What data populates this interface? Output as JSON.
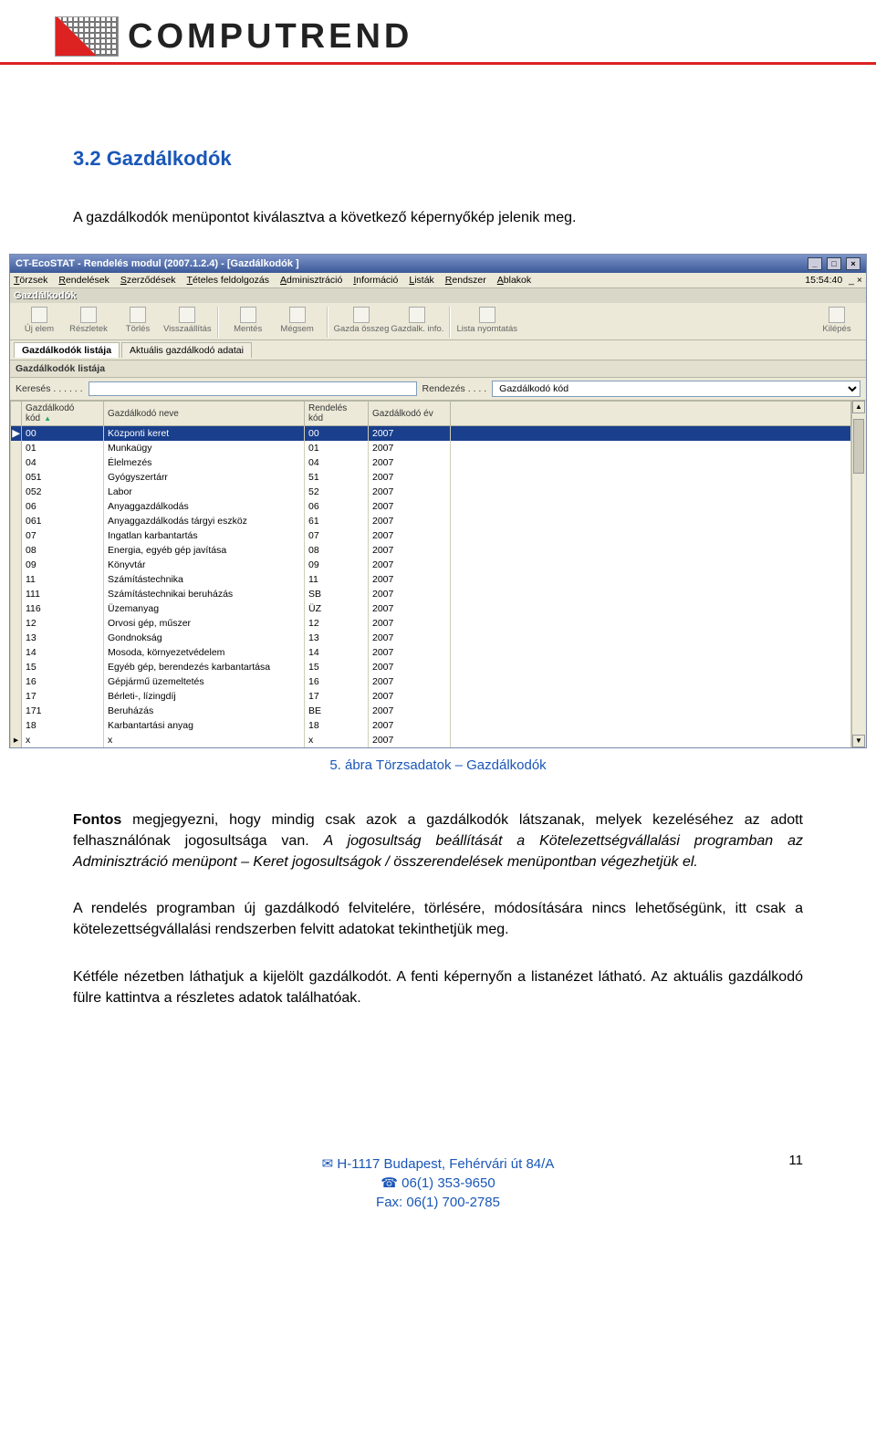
{
  "logo_text": "COMPUTREND",
  "section_title": "3.2  Gazdálkodók",
  "intro": "A gazdálkodók menüpontot kiválasztva a következő képernyőkép jelenik meg.",
  "caption": "5. ábra Törzsadatok – Gazdálkodók",
  "para1_lead": "Fontos",
  "para1_rest": " megjegyezni, hogy mindig csak azok a gazdálkodók látszanak, melyek kezeléséhez az adott felhasználónak jogosultsága van. ",
  "para1_italic": "A jogosultság beállítását a Kötelezettségvállalási programban az Adminisztráció menüpont – Keret jogosultságok / összerendelések menüpontban végezhetjük el.",
  "para2": "A rendelés programban új gazdálkodó felvitelére, törlésére, módosítására nincs lehetőségünk, itt csak a kötelezettségvállalási rendszerben felvitt adatokat tekinthetjük meg.",
  "para3": "Kétféle nézetben láthatjuk a kijelölt gazdálkodót. A fenti képernyőn a listanézet látható.  Az aktuális gazdálkodó fülre kattintva a részletes adatok találhatóak.",
  "footer": {
    "line1": "✉ H-1117 Budapest, Fehérvári út 84/A",
    "line2": "☎ 06(1) 353-9650",
    "line3": "Fax: 06(1) 700-2785",
    "page": "11"
  },
  "app": {
    "title": "CT-EcoSTAT - Rendelés modul (2007.1.2.4) - [Gazdálkodók ]",
    "menus": [
      "Törzsek",
      "Rendelések",
      "Szerződések",
      "Tételes feldolgozás",
      "Adminisztráció",
      "Információ",
      "Listák",
      "Rendszer",
      "Ablakok"
    ],
    "clock": "15:54:40",
    "tabstrip": "Gazdálkodók",
    "toolbar": [
      {
        "label": "Új elem"
      },
      {
        "label": "Részletek"
      },
      {
        "label": "Törlés"
      },
      {
        "label": "Visszaállítás"
      },
      {
        "sep": true
      },
      {
        "label": "Mentés"
      },
      {
        "label": "Mégsem"
      },
      {
        "sep": true
      },
      {
        "label": "Gazda összeg"
      },
      {
        "label": "Gazdalk. info."
      },
      {
        "sep": true
      },
      {
        "label": "Lista nyomtatás"
      },
      {
        "spacer": true
      },
      {
        "label": "Kilépés"
      }
    ],
    "subtabs": [
      "Gazdálkodók listája",
      "Aktuális gazdálkodó adatai"
    ],
    "panel_header": "Gazdálkodók listája",
    "search_label": "Keresés . . . . . .",
    "sort_label": "Rendezés . . . .",
    "sort_value": "Gazdálkodó kód",
    "columns": [
      "Gazdálkodó kód",
      "Gazdálkodó neve",
      "Rendelés kód",
      "Gazdálkodó év"
    ],
    "rows": [
      {
        "sel": true,
        "marker": "▶",
        "kod": "00",
        "nev": "Központi keret",
        "rkod": "00",
        "ev": "2007"
      },
      {
        "kod": "01",
        "nev": "Munkaügy",
        "rkod": "01",
        "ev": "2007"
      },
      {
        "kod": "04",
        "nev": "Élelmezés",
        "rkod": "04",
        "ev": "2007"
      },
      {
        "kod": "051",
        "nev": "Gyógyszertárr",
        "rkod": "51",
        "ev": "2007"
      },
      {
        "kod": "052",
        "nev": "Labor",
        "rkod": "52",
        "ev": "2007"
      },
      {
        "kod": "06",
        "nev": "Anyaggazdálkodás",
        "rkod": "06",
        "ev": "2007"
      },
      {
        "kod": "061",
        "nev": "Anyaggazdálkodás tárgyi eszköz",
        "rkod": "61",
        "ev": "2007"
      },
      {
        "kod": "07",
        "nev": "Ingatlan karbantartás",
        "rkod": "07",
        "ev": "2007"
      },
      {
        "kod": "08",
        "nev": "Energia, egyéb gép javítása",
        "rkod": "08",
        "ev": "2007"
      },
      {
        "kod": "09",
        "nev": "Könyvtár",
        "rkod": "09",
        "ev": "2007"
      },
      {
        "kod": "11",
        "nev": "Számítástechnika",
        "rkod": "11",
        "ev": "2007"
      },
      {
        "kod": "111",
        "nev": "Számítástechnikai beruházás",
        "rkod": "SB",
        "ev": "2007"
      },
      {
        "kod": "116",
        "nev": "Üzemanyag",
        "rkod": "ÜZ",
        "ev": "2007"
      },
      {
        "kod": "12",
        "nev": "Orvosi gép, műszer",
        "rkod": "12",
        "ev": "2007"
      },
      {
        "kod": "13",
        "nev": "Gondnokság",
        "rkod": "13",
        "ev": "2007"
      },
      {
        "kod": "14",
        "nev": "Mosoda, környezetvédelem",
        "rkod": "14",
        "ev": "2007"
      },
      {
        "kod": "15",
        "nev": "Egyéb gép, berendezés karbantartása",
        "rkod": "15",
        "ev": "2007"
      },
      {
        "kod": "16",
        "nev": "Gépjármű üzemeltetés",
        "rkod": "16",
        "ev": "2007"
      },
      {
        "kod": "17",
        "nev": "Bérleti-, lízingdíj",
        "rkod": "17",
        "ev": "2007"
      },
      {
        "kod": "171",
        "nev": "Beruházás",
        "rkod": "BE",
        "ev": "2007"
      },
      {
        "kod": "18",
        "nev": "Karbantartási anyag",
        "rkod": "18",
        "ev": "2007"
      },
      {
        "marker": "▸",
        "kod": "x",
        "nev": "x",
        "rkod": "x",
        "ev": "2007"
      }
    ]
  }
}
